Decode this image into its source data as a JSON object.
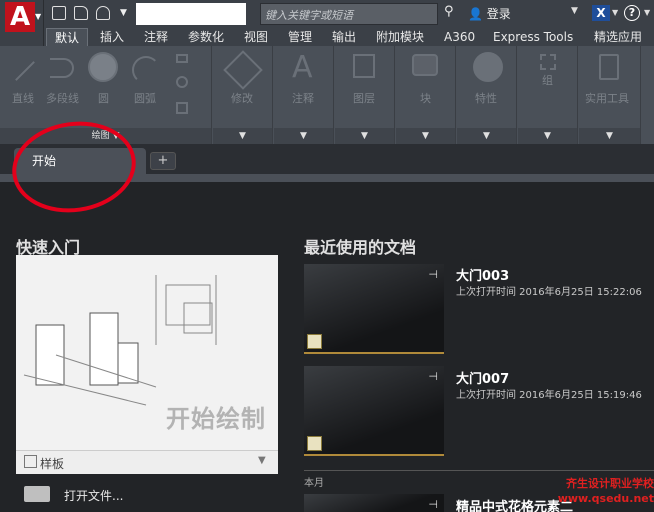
{
  "titlebar": {
    "app_icon": "A",
    "search_placeholder": "键入关键字或短语",
    "login_label": "登录",
    "help_label": "?"
  },
  "ribbon_tabs": [
    "默认",
    "插入",
    "注释",
    "参数化",
    "视图",
    "管理",
    "输出",
    "附加模块",
    "A360",
    "Express Tools",
    "精选应用"
  ],
  "ribbon": {
    "draw_tools": [
      "直线",
      "多段线",
      "圆",
      "圆弧"
    ],
    "draw_panel_label": "绘图",
    "panels": [
      "修改",
      "注释",
      "图层",
      "块",
      "特性",
      "组",
      "实用工具"
    ]
  },
  "file_tabs": {
    "start_label": "开始",
    "add_label": "+"
  },
  "quick_start": {
    "title": "快速入门",
    "start_drawing": "开始绘制",
    "template_label": "样板",
    "open_file_label": "打开文件..."
  },
  "recent": {
    "title": "最近使用的文档",
    "documents": [
      {
        "name": "大门003",
        "time": "上次打开时间 2016年6月25日 15:22:06"
      },
      {
        "name": "大门007",
        "time": "上次打开时间 2016年6月25日 15:19:46"
      },
      {
        "name": "精品中式花格元素二",
        "time": ""
      }
    ],
    "month_label": "本月"
  },
  "watermark": {
    "line1": "齐生设计职业学校",
    "line2": "www.qsedu.net"
  },
  "colors": {
    "accent_red": "#c1121c",
    "annotation_red": "#e4001b",
    "ribbon_bg": "#4a5058"
  }
}
